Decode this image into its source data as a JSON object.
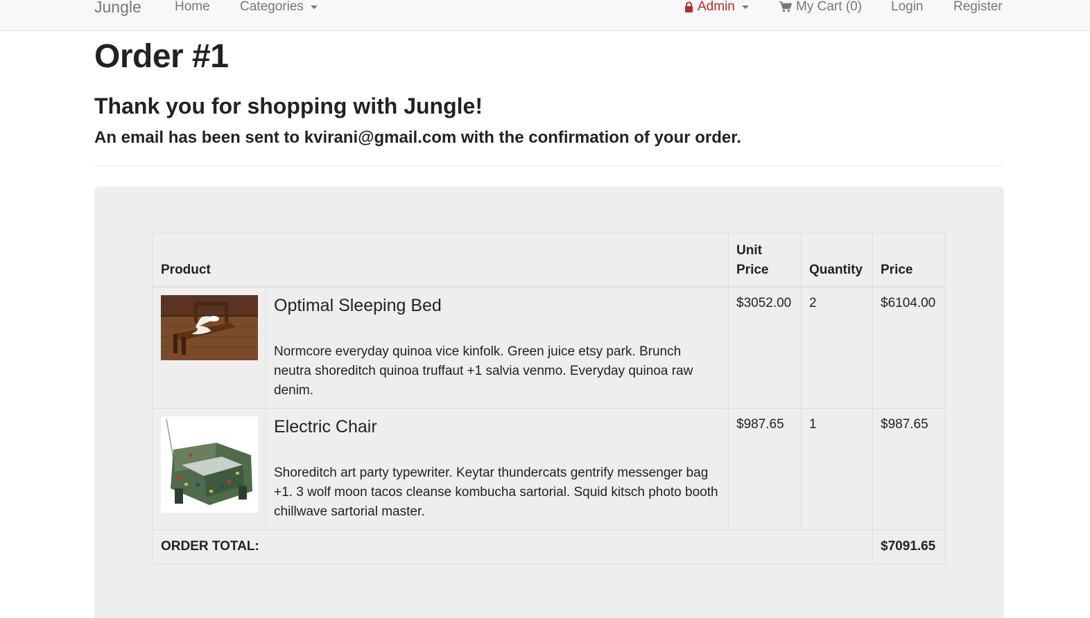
{
  "navbar": {
    "brand": "Jungle",
    "home": "Home",
    "categories": "Categories",
    "admin": "Admin",
    "cart": "My Cart (0)",
    "login": "Login",
    "register": "Register",
    "admin_color": "#b52b2b"
  },
  "page": {
    "title": "Order #1",
    "thanks": "Thank you for shopping with Jungle!",
    "email_note": "An email has been sent to kvirani@gmail.com with the confirmation of your order."
  },
  "table": {
    "headers": {
      "product": "Product",
      "unit_price": "Unit Price",
      "quantity": "Quantity",
      "price": "Price"
    },
    "rows": [
      {
        "name": "Optimal Sleeping Bed",
        "description": "Normcore everyday quinoa vice kinfolk. Green juice etsy park. Brunch neutra shoreditch quinoa truffaut +1 salvia venmo. Everyday quinoa raw denim.",
        "unit_price": "$3052.00",
        "quantity": "2",
        "price": "$6104.00",
        "image": "bed-photo"
      },
      {
        "name": "Electric Chair",
        "description": "Shoreditch art party typewriter. Keytar thundercats gentrify messenger bag +1. 3 wolf moon tacos cleanse kombucha sartorial. Squid kitsch photo booth chillwave sartorial master.",
        "unit_price": "$987.65",
        "quantity": "1",
        "price": "$987.65",
        "image": "chair-photo"
      }
    ],
    "total_label": "ORDER TOTAL:",
    "total_value": "$7091.65"
  }
}
